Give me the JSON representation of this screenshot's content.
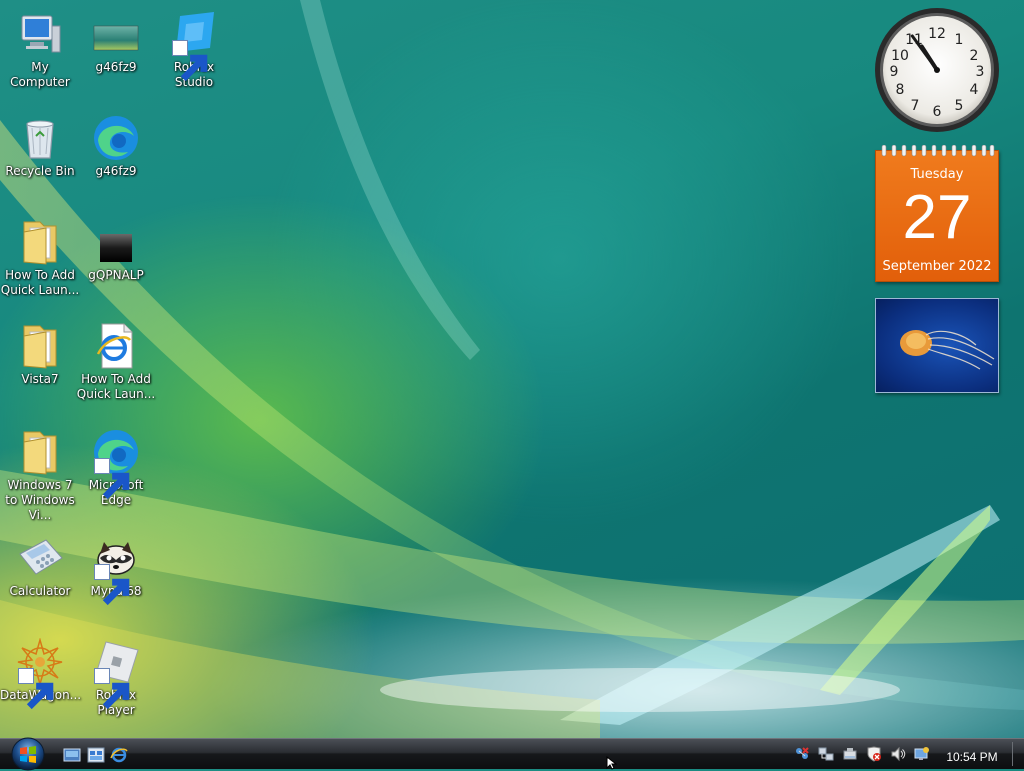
{
  "desktop": {
    "icons": [
      {
        "label": "My Computer",
        "icon": "computer-icon"
      },
      {
        "label": "g46fz9",
        "icon": "image-file-icon"
      },
      {
        "label": "Roblox Studio",
        "icon": "roblox-studio-icon"
      },
      {
        "label": "Recycle Bin",
        "icon": "recycle-bin-icon"
      },
      {
        "label": "g46fz9",
        "icon": "edge-icon"
      },
      {
        "label": "How To Add Quick Laun...",
        "icon": "folder-icon"
      },
      {
        "label": "gQPNALP",
        "icon": "black-image-icon"
      },
      {
        "label": "Vista7",
        "icon": "folder-icon"
      },
      {
        "label": "How To Add Quick Laun...",
        "icon": "ie-document-icon"
      },
      {
        "label": "Windows 7 to Windows Vi...",
        "icon": "folder-icon"
      },
      {
        "label": "Microsoft Edge",
        "icon": "edge-icon"
      },
      {
        "label": "Calculator",
        "icon": "calculator-icon"
      },
      {
        "label": "Mypal68",
        "icon": "raccoon-icon"
      },
      {
        "label": "DataWagon...",
        "icon": "datawagon-icon"
      },
      {
        "label": "Roblox Player",
        "icon": "roblox-player-icon"
      }
    ]
  },
  "gadgets": {
    "clock": {
      "hour": 10,
      "minute": 54
    },
    "calendar": {
      "weekday": "Tuesday",
      "day": "27",
      "month_year": "September 2022"
    },
    "slideshow": {
      "subject": "jellyfish-photo"
    }
  },
  "taskbar": {
    "start": "start-orb-icon",
    "quick_launch": [
      "show-desktop-icon",
      "switch-windows-icon",
      "ie-icon"
    ],
    "tray_icons": [
      "network-icon",
      "network-activity-icon",
      "safely-remove-icon",
      "security-alert-icon",
      "volume-icon",
      "display-icon"
    ],
    "time": "10:54 PM"
  },
  "colors": {
    "calendar_orange": "#e8670f",
    "taskbar_dark": "#16181b"
  }
}
